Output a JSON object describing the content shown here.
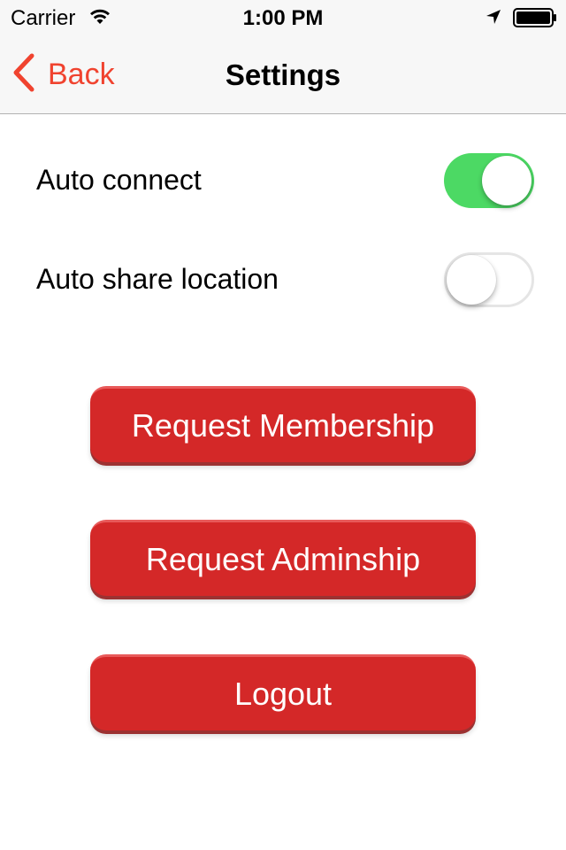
{
  "status_bar": {
    "carrier": "Carrier",
    "time": "1:00 PM",
    "icons": [
      "wifi-icon",
      "location-arrow-icon",
      "battery-icon"
    ]
  },
  "nav": {
    "back_label": "Back",
    "title": "Settings",
    "accent_color": "#f0432f"
  },
  "settings": {
    "auto_connect": {
      "label": "Auto connect",
      "state": "on"
    },
    "auto_share_location": {
      "label": "Auto share location",
      "state": "off"
    }
  },
  "buttons": {
    "request_membership": "Request Membership",
    "request_adminship": "Request Adminship",
    "logout": "Logout",
    "color": "#d42828"
  }
}
